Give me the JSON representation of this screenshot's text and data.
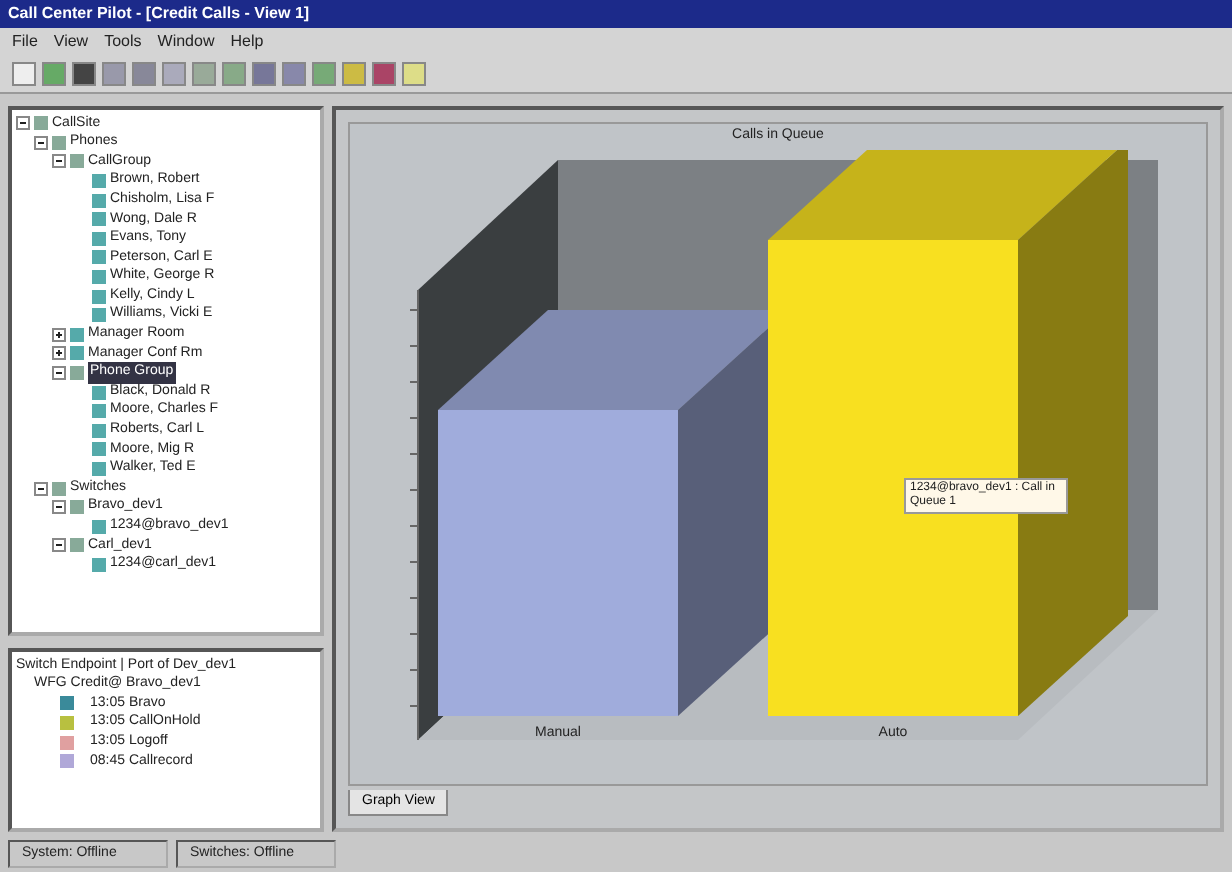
{
  "window": {
    "title": "Call Center Pilot - [Credit Calls - View 1]"
  },
  "menu": [
    "File",
    "View",
    "Tools",
    "Window",
    "Help"
  ],
  "tree": [
    {
      "label": "CallSite",
      "expanded": true,
      "selected": false,
      "children": [
        {
          "label": "Phones",
          "expanded": true,
          "selected": false,
          "children": [
            {
              "label": "CallGroup",
              "expanded": true,
              "selected": false,
              "children": [
                {
                  "label": "Brown, Robert"
                },
                {
                  "label": "Chisholm, Lisa F"
                },
                {
                  "label": "Wong, Dale R"
                },
                {
                  "label": "Evans, Tony"
                },
                {
                  "label": "Peterson, Carl E"
                },
                {
                  "label": "White, George R"
                },
                {
                  "label": "Kelly, Cindy L"
                },
                {
                  "label": "Williams, Vicki E"
                }
              ]
            },
            {
              "label": "Manager Room",
              "expanded": false,
              "selected": false
            },
            {
              "label": "Manager Conf Rm",
              "expanded": false,
              "selected": false
            },
            {
              "label": "Phone Group",
              "expanded": true,
              "selected": true,
              "children": [
                {
                  "label": "Black, Donald R"
                },
                {
                  "label": "Moore, Charles F"
                },
                {
                  "label": "Roberts, Carl L"
                },
                {
                  "label": "Moore, Mig R"
                },
                {
                  "label": "Walker, Ted E"
                }
              ]
            }
          ]
        },
        {
          "label": "Switches",
          "expanded": true,
          "selected": false,
          "children": [
            {
              "label": "Bravo_dev1",
              "expanded": true,
              "selected": false,
              "children": [
                {
                  "label": "1234@bravo_dev1"
                }
              ]
            },
            {
              "label": "Carl_dev1",
              "expanded": true,
              "selected": false,
              "children": [
                {
                  "label": "1234@carl_dev1"
                }
              ]
            }
          ]
        }
      ]
    }
  ],
  "details": {
    "header": "Switch Endpoint | Port of Dev_dev1",
    "group": "WFG Credit@ Bravo_dev1",
    "items": [
      {
        "label": "13:05 Bravo",
        "color": "#3a8a9a"
      },
      {
        "label": "13:05 CallOnHold",
        "color": "#b8c040"
      },
      {
        "label": "13:05 Logoff",
        "color": "#e0a0a0"
      },
      {
        "label": "08:45 Callrecord",
        "color": "#b0a8d8"
      }
    ]
  },
  "chart": {
    "title": "Calls in Queue",
    "bars": [
      {
        "label": "Manual",
        "color": "#a0acdc"
      },
      {
        "label": "Auto",
        "color": "#f8e020"
      }
    ],
    "tooltip": "1234@bravo_dev1 : Call in Queue 1"
  },
  "tab": {
    "label": "Graph View",
    "selected": true
  },
  "status_bar": [
    "System: Offline",
    "Switches: Offline"
  ]
}
